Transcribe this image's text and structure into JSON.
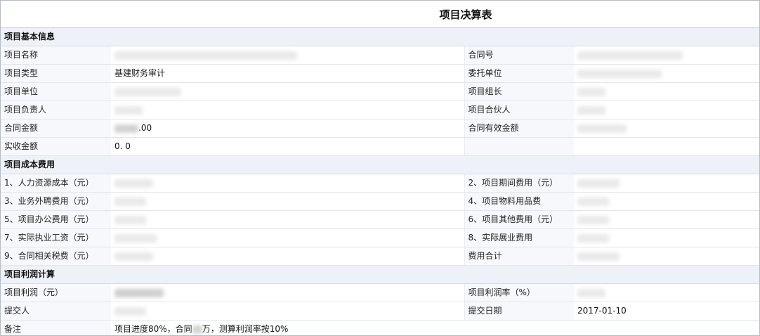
{
  "page": {
    "title": "项目决算表"
  },
  "sections": {
    "basic": "项目基本信息",
    "cost": "项目成本费用",
    "profit": "项目利润计算"
  },
  "basic": {
    "project_name_label": "项目名称",
    "contract_no_label": "合同号",
    "project_type_label": "项目类型",
    "project_type_value": "基建财务审计",
    "client_label": "委托单位",
    "project_unit_label": "项目单位",
    "team_leader_label": "项目组长",
    "manager_label": "项目负责人",
    "partner_label": "项目合伙人",
    "contract_amount_label": "合同金额",
    "contract_amount_suffix": ".00",
    "effective_amount_label": "合同有效金额",
    "received_amount_label": "实收金额",
    "received_amount_value": "0. 0"
  },
  "cost": {
    "hr_cost_label": "1、人力资源成本（元）",
    "period_cost_label": "2、项目期间费用（元）",
    "outsourcing_label": "3、业务外聘费用（元）",
    "materials_label": "4、项目物料用品费",
    "office_label": "5、项目办公费用（元）",
    "other_label": "6、项目其他费用（元）",
    "wages_label": "7、实际执业工资（元）",
    "expansion_label": "8、实际展业费用",
    "tax_label": "9、合同相关税费（元）",
    "total_label": "费用合计"
  },
  "profit": {
    "profit_label": "项目利润（元）",
    "profit_rate_label": "项目利润率（%）",
    "submitter_label": "提交人",
    "submit_date_label": "提交日期",
    "submit_date_value": "2017-01-10",
    "remark_label": "备注",
    "remark_part1": "项目进度80%，合同",
    "remark_part2": "万，测算利润率按10%"
  }
}
